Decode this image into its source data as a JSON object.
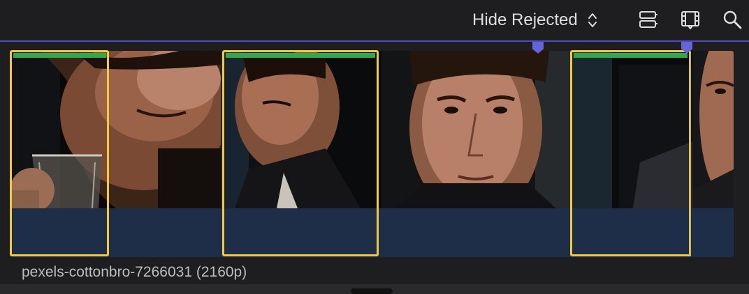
{
  "toolbar": {
    "filter_label": "Hide Rejected",
    "icons": [
      "sort-chevrons-icon",
      "clip-appearance-icon",
      "filmstrip-icon",
      "search-icon"
    ]
  },
  "browser": {
    "clip_name": "pexels-cottonbro-7266031 (2160p)"
  },
  "colors": {
    "accent": "#4d4cc6",
    "selection": "#f5c842",
    "favorite": "#2fa84e",
    "marker": "#6565d8",
    "audio_area": "#1f2e48"
  }
}
